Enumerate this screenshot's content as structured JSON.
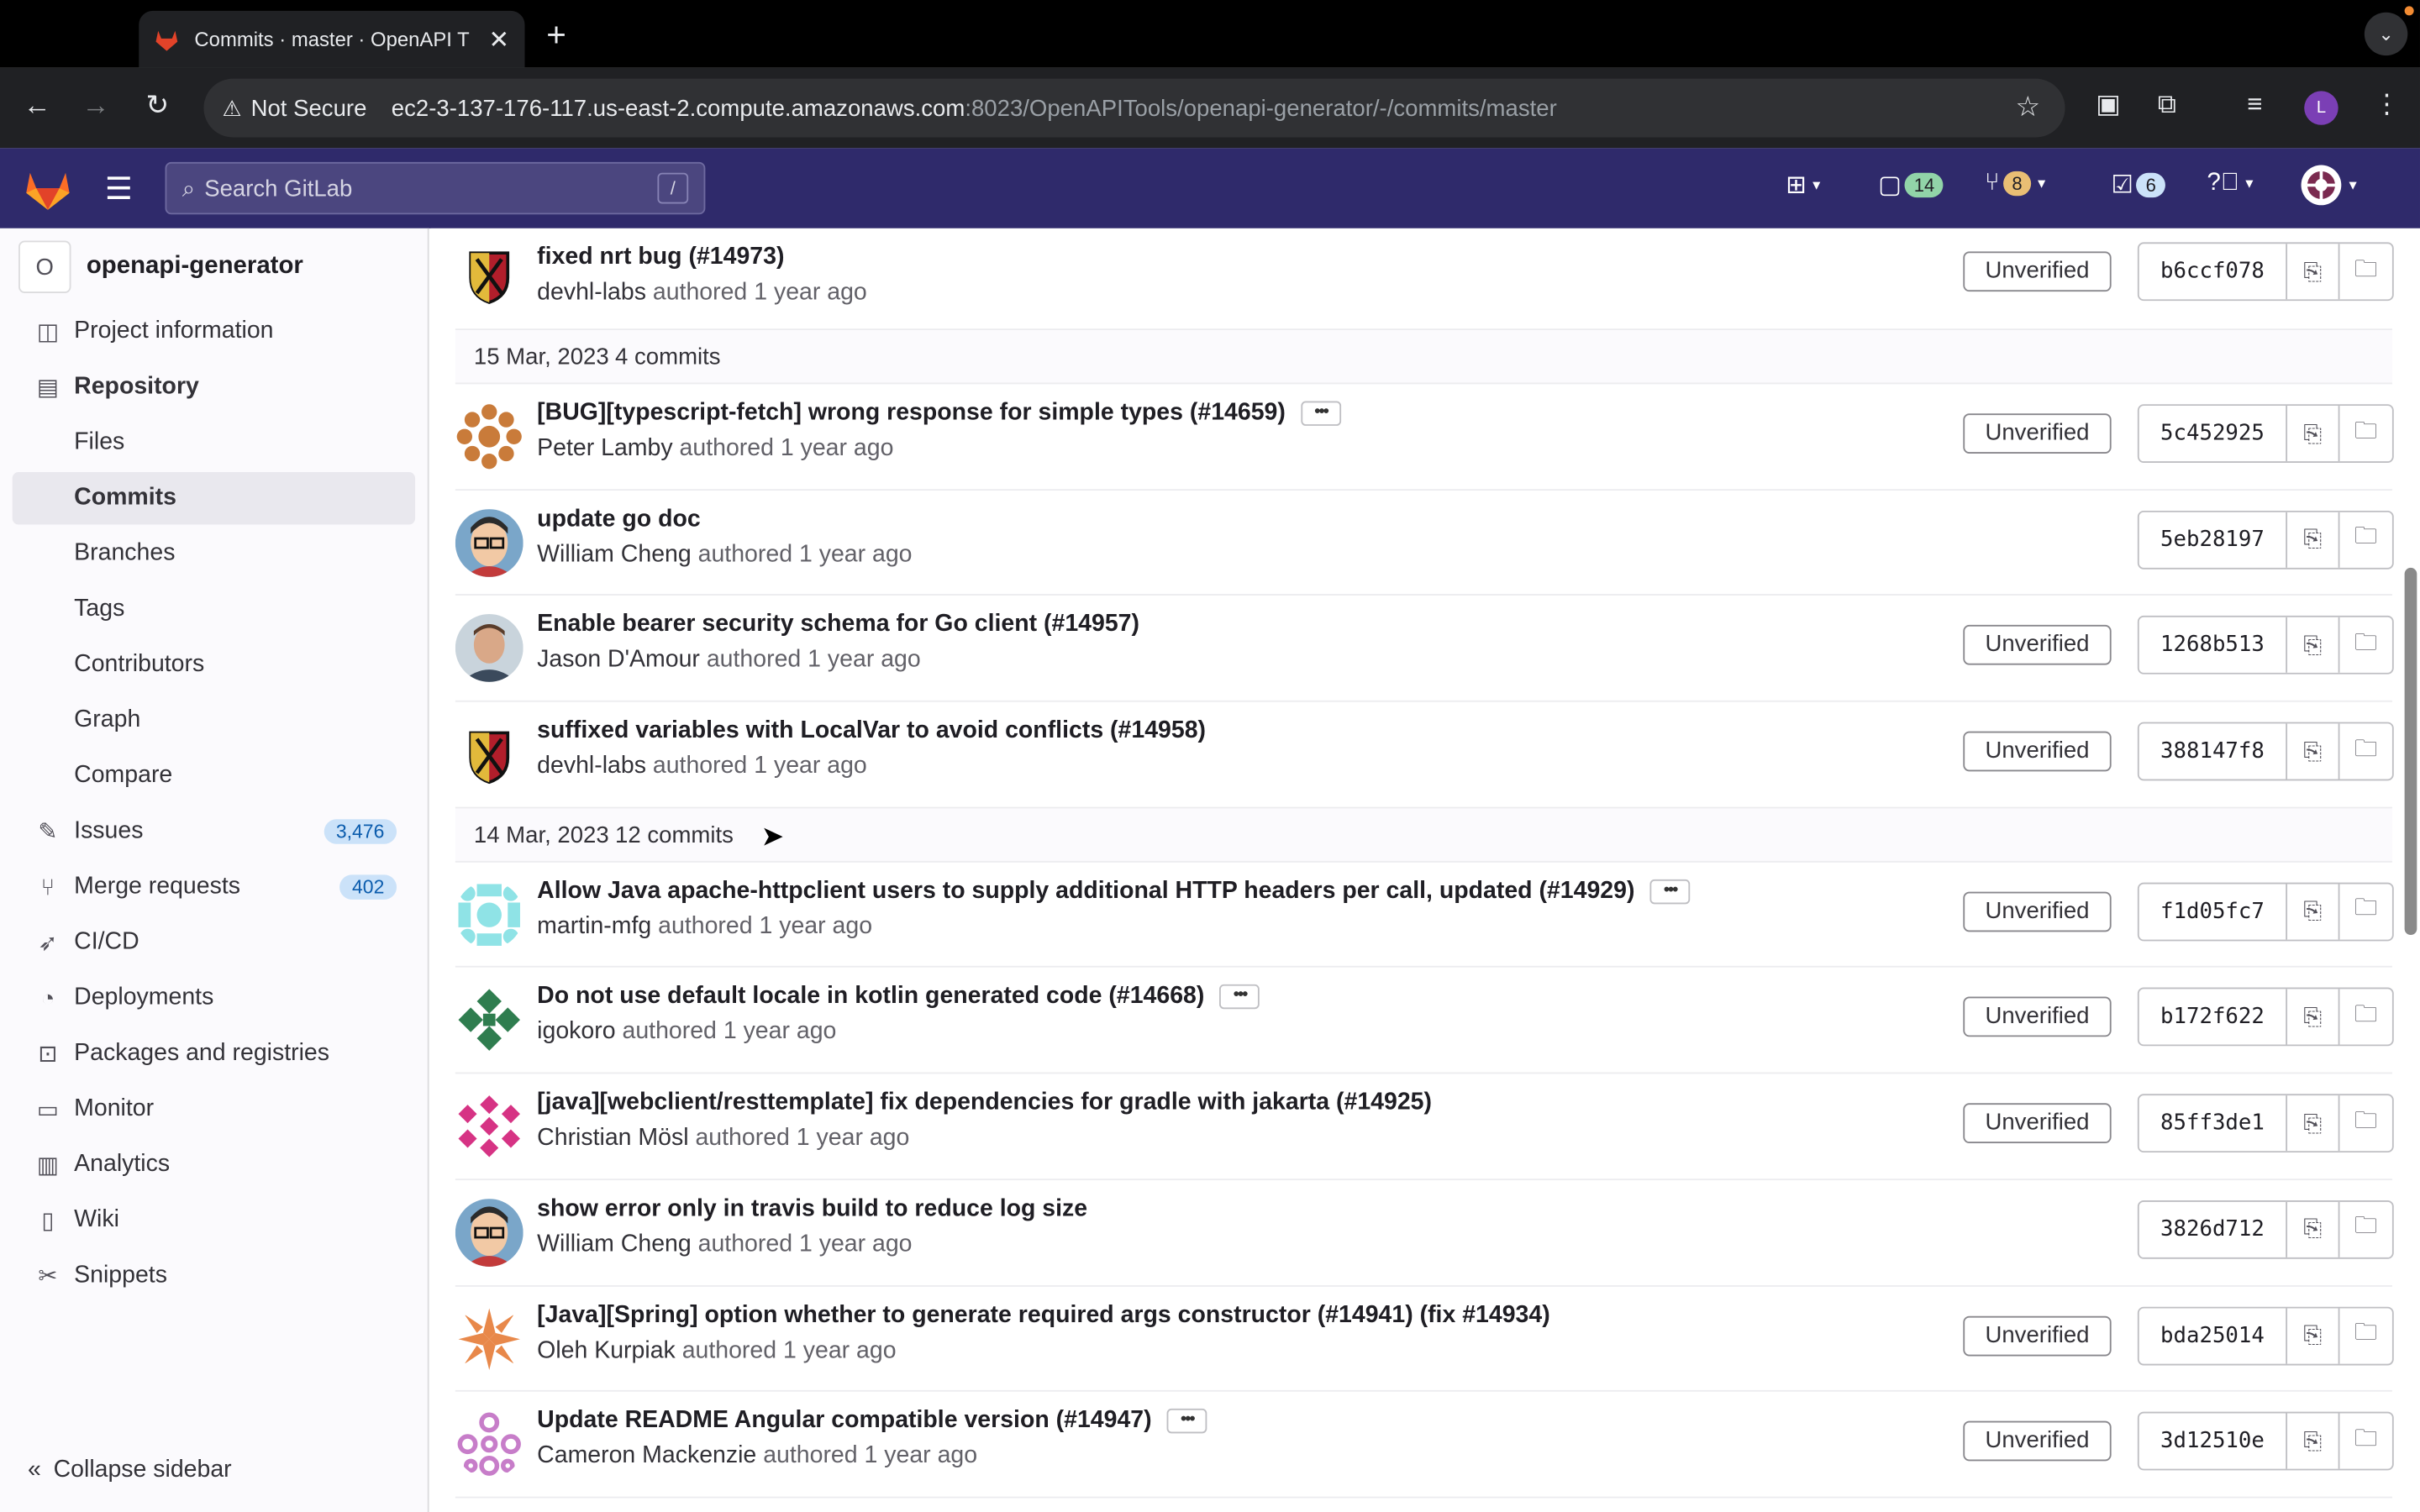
{
  "browser": {
    "tab_title": "Commits · master · OpenAPI T",
    "security_label": "Not Secure",
    "url_host": "ec2-3-137-176-117.us-east-2.compute.amazonaws.com",
    "url_path": ":8023/OpenAPITools/openapi-generator/-/commits/master",
    "profile_initial": "L"
  },
  "header": {
    "search_placeholder": "Search GitLab",
    "search_shortcut": "/",
    "issues_count": "14",
    "mr_count": "8",
    "todo_count": "6"
  },
  "sidebar": {
    "project_initial": "O",
    "project_name": "openapi-generator",
    "items": {
      "project_information": "Project information",
      "repository": "Repository",
      "files": "Files",
      "commits": "Commits",
      "branches": "Branches",
      "tags": "Tags",
      "contributors": "Contributors",
      "graph": "Graph",
      "compare": "Compare",
      "issues": "Issues",
      "issues_count": "3,476",
      "merge_requests": "Merge requests",
      "merge_requests_count": "402",
      "cicd": "CI/CD",
      "deployments": "Deployments",
      "packages": "Packages and registries",
      "monitor": "Monitor",
      "analytics": "Analytics",
      "wiki": "Wiki",
      "snippets": "Snippets"
    },
    "collapse": "Collapse sidebar"
  },
  "labels": {
    "authored": "authored",
    "unverified": "Unverified"
  },
  "commits": {
    "c0": {
      "title": "fixed nrt bug (#14973)",
      "author": "devhl-labs",
      "time": "1 year ago",
      "sha": "b6ccf078"
    },
    "d1": {
      "date": "15 Mar, 2023",
      "count": "4 commits"
    },
    "c1": {
      "title": "[BUG][typescript-fetch] wrong response for simple types (#14659)",
      "author": "Peter Lamby",
      "time": "1 year ago",
      "sha": "5c452925"
    },
    "c2": {
      "title": "update go doc",
      "author": "William Cheng",
      "time": "1 year ago",
      "sha": "5eb28197"
    },
    "c3": {
      "title": "Enable bearer security schema for Go client (#14957)",
      "author": "Jason D'Amour",
      "time": "1 year ago",
      "sha": "1268b513"
    },
    "c4": {
      "title": "suffixed variables with LocalVar to avoid conflicts (#14958)",
      "author": "devhl-labs",
      "time": "1 year ago",
      "sha": "388147f8"
    },
    "d2": {
      "date": "14 Mar, 2023",
      "count": "12 commits"
    },
    "c5": {
      "title": "Allow Java apache-httpclient users to supply additional HTTP headers per call, updated (#14929)",
      "author": "martin-mfg",
      "time": "1 year ago",
      "sha": "f1d05fc7"
    },
    "c6": {
      "title": "Do not use default locale in kotlin generated code (#14668)",
      "author": "igokoro",
      "time": "1 year ago",
      "sha": "b172f622"
    },
    "c7": {
      "title": "[java][webclient/resttemplate] fix dependencies for gradle with jakarta (#14925)",
      "author": "Christian Mösl",
      "time": "1 year ago",
      "sha": "85ff3de1"
    },
    "c8": {
      "title": "show error only in travis build to reduce log size",
      "author": "William Cheng",
      "time": "1 year ago",
      "sha": "3826d712"
    },
    "c9": {
      "title": "[Java][Spring] option whether to generate required args constructor (#14941) (fix #14934)",
      "author": "Oleh Kurpiak",
      "time": "1 year ago",
      "sha": "bda25014"
    },
    "c10": {
      "title": "Update README Angular compatible version (#14947)",
      "author": "Cameron Mackenzie",
      "time": "1 year ago",
      "sha": "3d12510e"
    }
  },
  "colors": {
    "header_bg": "#2f2a6b",
    "sidebar_bg": "#fbfafd",
    "badge_blue": "#cbe2f9"
  }
}
